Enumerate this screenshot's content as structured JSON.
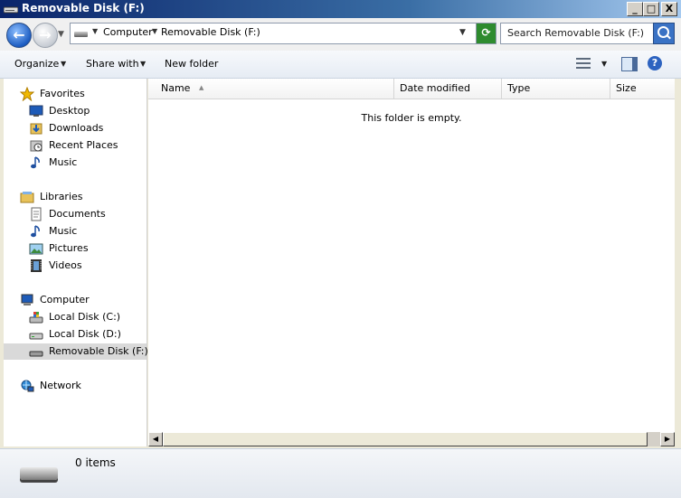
{
  "window": {
    "title": "Removable Disk (F:)"
  },
  "titlebar_buttons": {
    "minimize": "_",
    "maximize": "□",
    "close": "X"
  },
  "address": {
    "crumbs": [
      "Computer",
      "Removable Disk (F:)"
    ]
  },
  "search": {
    "placeholder": "Search Removable Disk (F:)"
  },
  "toolbar": {
    "organize": "Organize",
    "share_with": "Share with",
    "new_folder": "New folder"
  },
  "sidebar": {
    "items": [
      {
        "label": "Favorites",
        "icon": "star-icon"
      },
      {
        "label": "Desktop",
        "icon": "desktop-icon"
      },
      {
        "label": "Downloads",
        "icon": "downloads-icon"
      },
      {
        "label": "Recent Places",
        "icon": "recent-places-icon"
      },
      {
        "label": "Music",
        "icon": "music-icon"
      },
      {
        "label": "Libraries",
        "icon": "libraries-icon"
      },
      {
        "label": "Documents",
        "icon": "documents-icon"
      },
      {
        "label": "Music",
        "icon": "music-icon"
      },
      {
        "label": "Pictures",
        "icon": "pictures-icon"
      },
      {
        "label": "Videos",
        "icon": "videos-icon"
      },
      {
        "label": "Computer",
        "icon": "computer-icon"
      },
      {
        "label": "Local Disk (C:)",
        "icon": "local-disk-icon"
      },
      {
        "label": "Local Disk (D:)",
        "icon": "local-disk-icon"
      },
      {
        "label": "Removable Disk (F:)",
        "icon": "removable-disk-icon",
        "selected": true
      },
      {
        "label": "Network",
        "icon": "network-icon"
      }
    ]
  },
  "columns": [
    "Name",
    "Date modified",
    "Type",
    "Size"
  ],
  "content": {
    "empty_message": "This folder is empty."
  },
  "status": {
    "count": "0 items"
  }
}
